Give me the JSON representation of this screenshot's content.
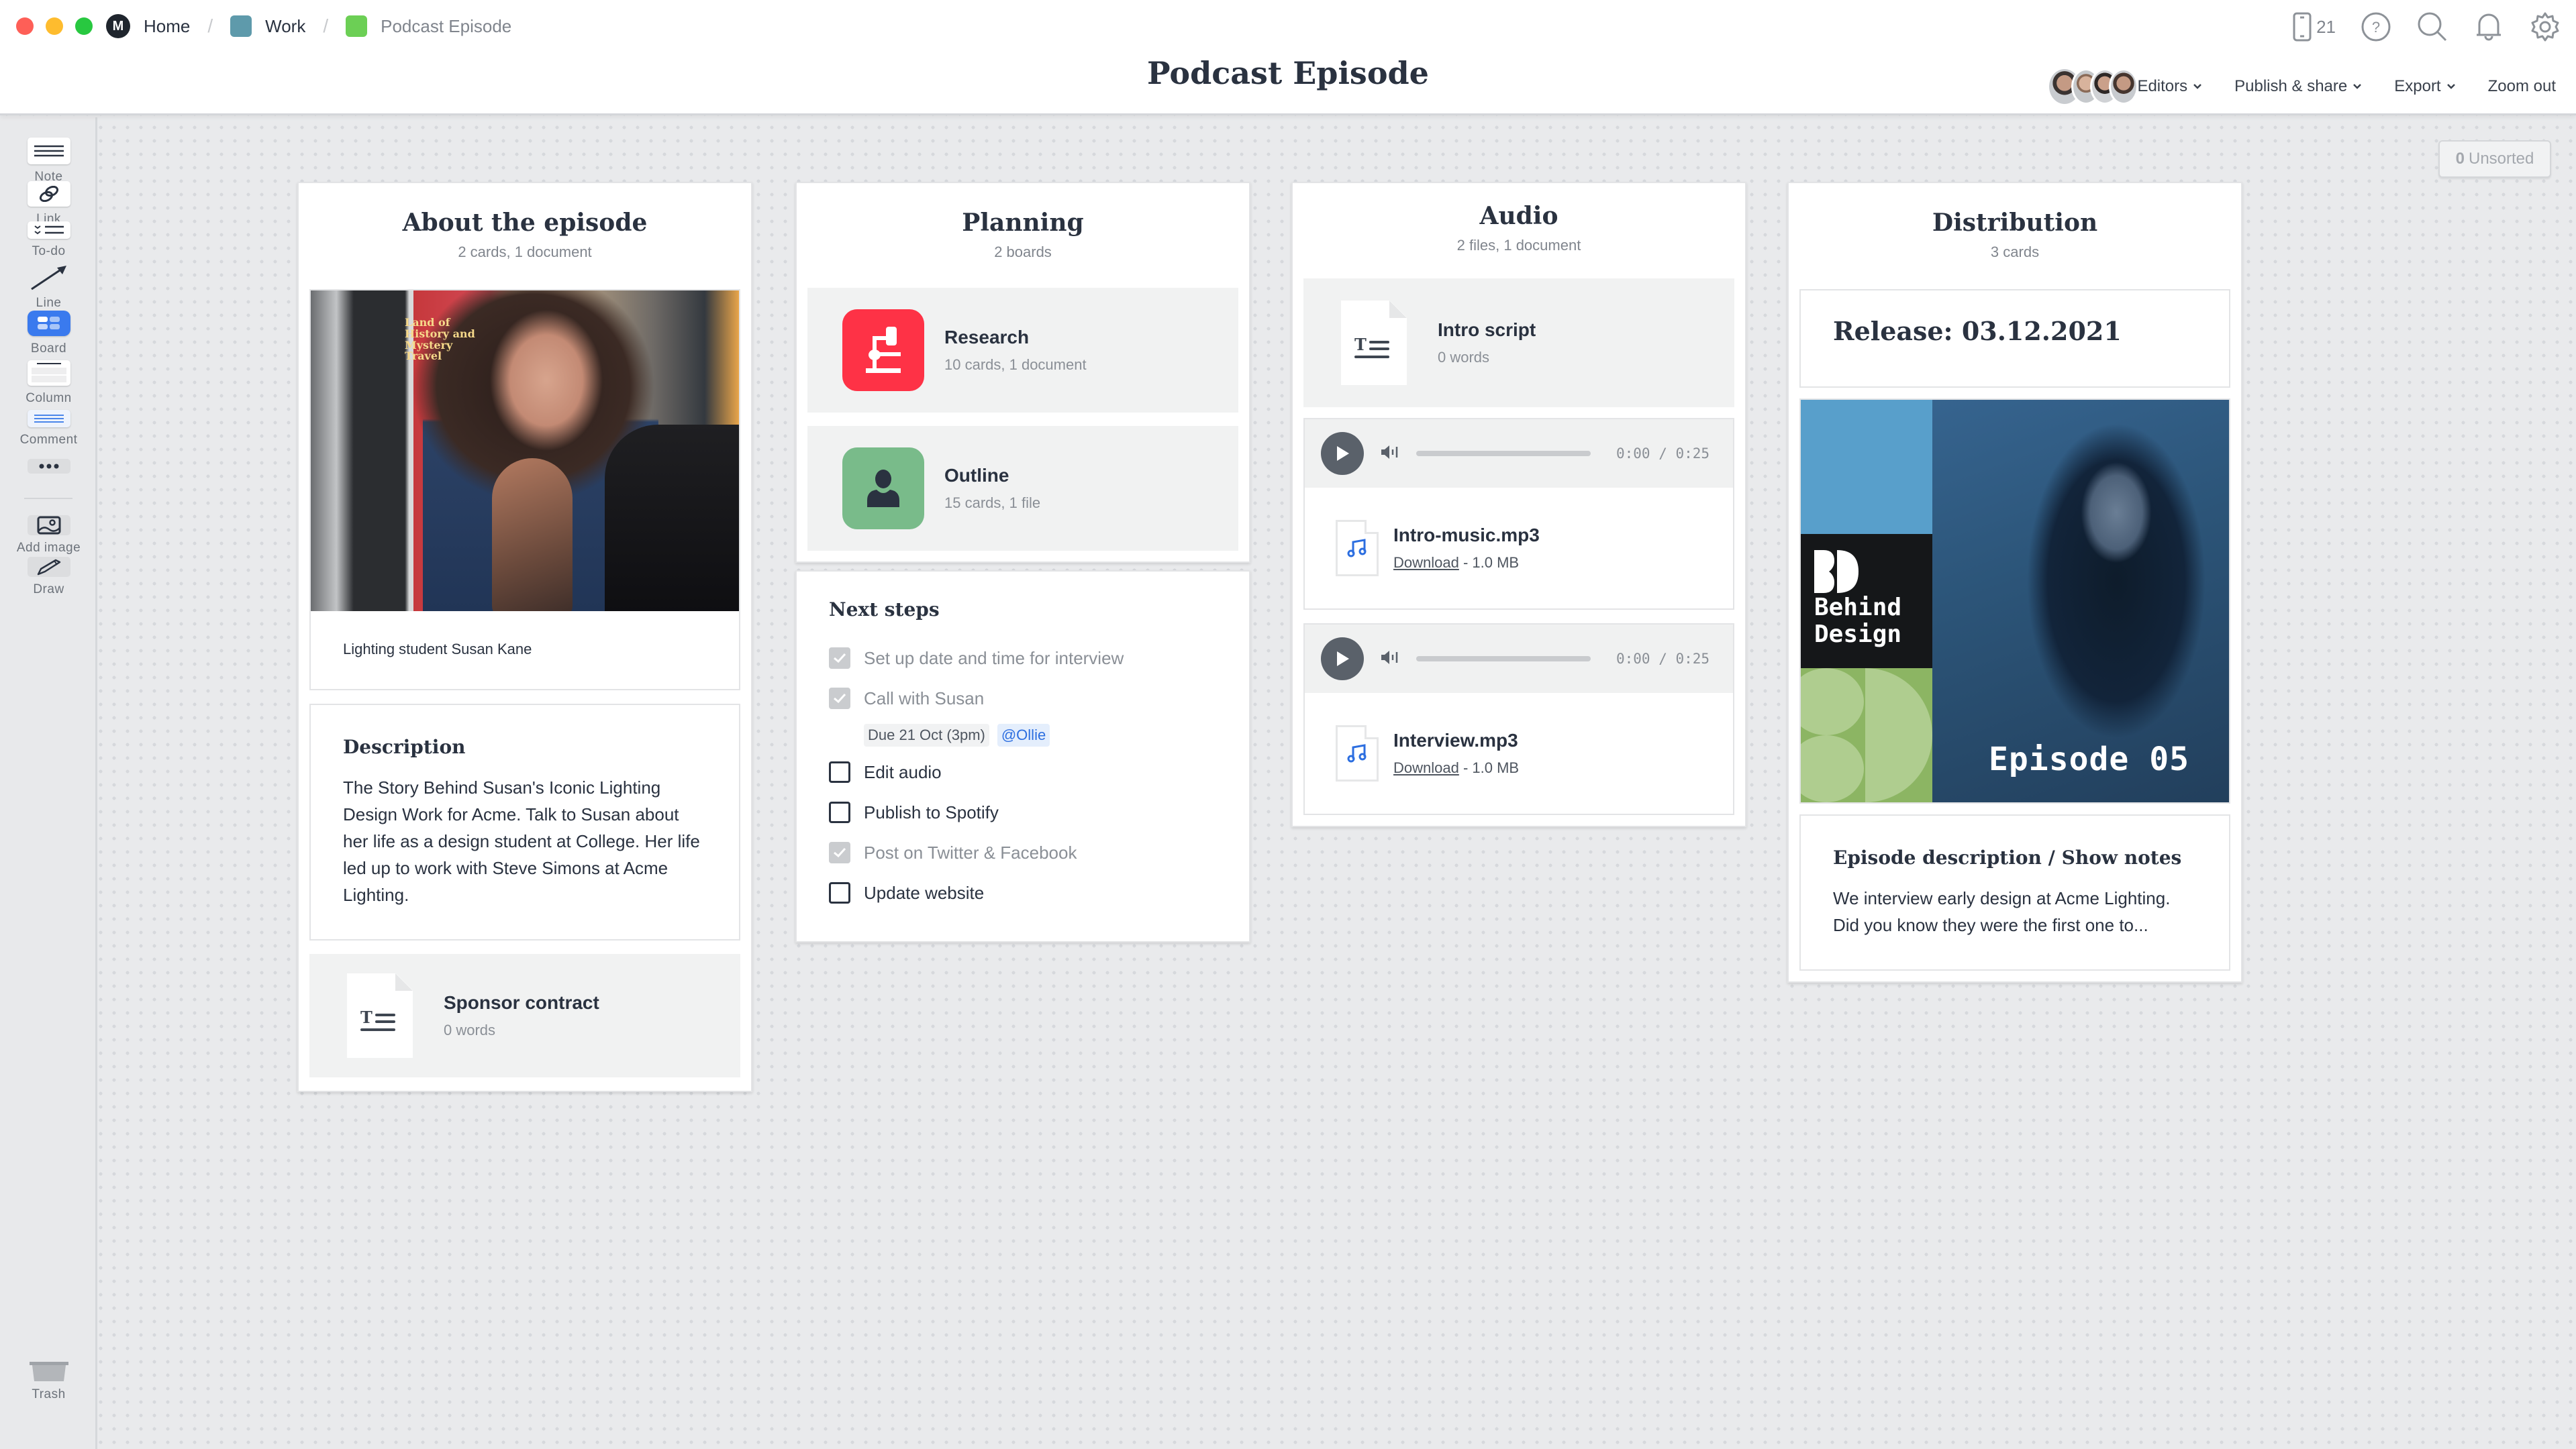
{
  "window": {
    "traffic_colors": {
      "close": "#fe5f57",
      "minimize": "#febc2e",
      "maximize": "#28c840"
    }
  },
  "breadcrumb": [
    {
      "label": "Home",
      "icon": "milanote-logo-icon"
    },
    {
      "label": "Work",
      "color": "#5e9aab"
    },
    {
      "label": "Podcast Episode",
      "color": "#6ccf55"
    }
  ],
  "header": {
    "title": "Podcast Episode",
    "device_count": "21",
    "icons": [
      "mobile-device-icon",
      "help-icon",
      "search-icon",
      "bell-icon",
      "gear-icon"
    ],
    "actions": {
      "editors": "Editors",
      "publish": "Publish & share",
      "export": "Export",
      "zoom_out": "Zoom out"
    }
  },
  "sidebar": {
    "tools": [
      {
        "label": "Note",
        "icon": "note-icon"
      },
      {
        "label": "Link",
        "icon": "link-icon"
      },
      {
        "label": "To-do",
        "icon": "todo-icon"
      },
      {
        "label": "Line",
        "icon": "line-arrow-icon"
      },
      {
        "label": "Board",
        "icon": "board-icon"
      },
      {
        "label": "Column",
        "icon": "column-icon"
      },
      {
        "label": "Comment",
        "icon": "comment-icon"
      },
      {
        "label": "",
        "icon": "more-icon"
      },
      {
        "label": "Add image",
        "icon": "image-icon"
      },
      {
        "label": "Draw",
        "icon": "pencil-icon"
      },
      {
        "label": "Trash",
        "icon": "trash-icon"
      }
    ]
  },
  "canvas": {
    "unsorted": {
      "count": "0",
      "label": "Unsorted"
    }
  },
  "columns": {
    "about": {
      "title": "About the episode",
      "subtitle": "2 cards, 1 document",
      "image_caption": "Lighting student Susan Kane",
      "image_poster_text": "Land of History and Mystery Travel",
      "description_title": "Description",
      "description_body": "The Story Behind Susan's Iconic Lighting Design Work for Acme. Talk to Susan about her life as a design student at College. Her life led up to work with Steve Simons at Acme Lighting.",
      "document": {
        "title": "Sponsor contract",
        "meta": "0 words"
      }
    },
    "planning": {
      "title": "Planning",
      "subtitle": "2 boards",
      "boards": [
        {
          "title": "Research",
          "meta": "10 cards, 1 document",
          "color": "#fe3246",
          "icon": "microscope-icon"
        },
        {
          "title": "Outline",
          "meta": "15 cards, 1 file",
          "color": "#79bb8a",
          "icon": "person-icon"
        }
      ],
      "todo": {
        "title": "Next steps",
        "items": [
          {
            "text": "Set up date and time for interview",
            "done": true
          },
          {
            "text": "Call with Susan",
            "done": true,
            "due": "Due 21 Oct (3pm)",
            "mention": "@Ollie"
          },
          {
            "text": "Edit audio",
            "done": false
          },
          {
            "text": "Publish to Spotify",
            "done": false
          },
          {
            "text": "Post on Twitter & Facebook",
            "done": true
          },
          {
            "text": "Update website",
            "done": false
          }
        ]
      }
    },
    "audio": {
      "title": "Audio",
      "subtitle": "2 files, 1 document",
      "document": {
        "title": "Intro script",
        "meta": "0 words"
      },
      "files": [
        {
          "name": "Intro-music.mp3",
          "download": "Download",
          "size": "- 1.0 MB",
          "time": "0:00 / 0:25",
          "progress": 0
        },
        {
          "name": "Interview.mp3",
          "download": "Download",
          "size": "- 1.0 MB",
          "time": "0:00 / 0:25",
          "progress": 0
        }
      ]
    },
    "distribution": {
      "title": "Distribution",
      "subtitle": "3 cards",
      "release": "Release: 03.12.2021",
      "cover": {
        "brand_line1": "Behind",
        "brand_line2": "Design",
        "episode": "Episode 05"
      },
      "notes_title": "Episode description / Show notes",
      "notes_body": "We interview early design at Acme Lighting. Did you know they were the first one to..."
    }
  }
}
